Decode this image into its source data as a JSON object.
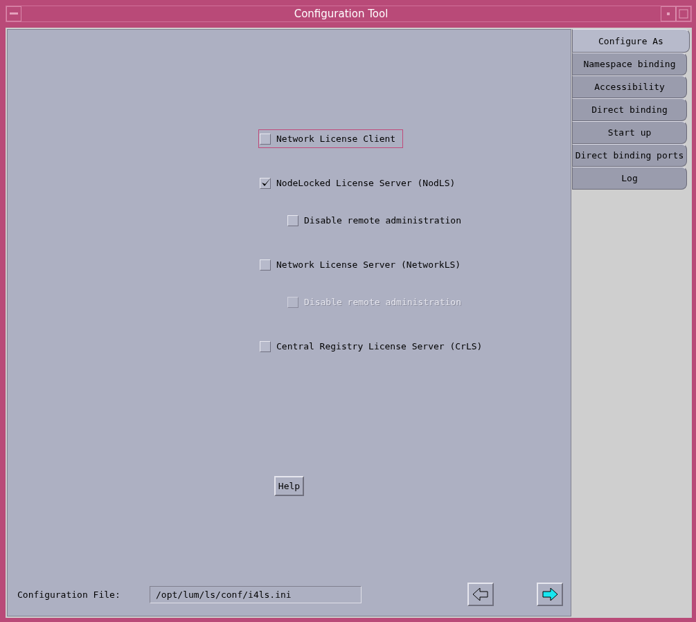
{
  "window": {
    "title": "Configuration Tool"
  },
  "options": [
    {
      "label": "Network License Client",
      "checked": false,
      "disabled": false,
      "focused": true
    },
    {
      "label": "NodeLocked License Server (NodLS)",
      "checked": true,
      "disabled": false,
      "focused": false,
      "children": [
        {
          "label": "Disable remote administration",
          "checked": false,
          "disabled": false,
          "focused": false
        }
      ]
    },
    {
      "label": "Network License Server (NetworkLS)",
      "checked": false,
      "disabled": false,
      "focused": false,
      "children": [
        {
          "label": "Disable remote administration",
          "checked": false,
          "disabled": true,
          "focused": false
        }
      ]
    },
    {
      "label": "Central Registry License Server (CrLS)",
      "checked": false,
      "disabled": false,
      "focused": false
    }
  ],
  "help_button": "Help",
  "config_file": {
    "label": "Configuration File:",
    "value": "/opt/lum/ls/conf/i4ls.ini"
  },
  "tabs": [
    {
      "label": "Configure As",
      "selected": true
    },
    {
      "label": "Namespace binding",
      "selected": false
    },
    {
      "label": "Accessibility",
      "selected": false
    },
    {
      "label": "Direct binding",
      "selected": false
    },
    {
      "label": "Start up",
      "selected": false
    },
    {
      "label": "Direct binding ports",
      "selected": false
    },
    {
      "label": "Log",
      "selected": false
    }
  ]
}
